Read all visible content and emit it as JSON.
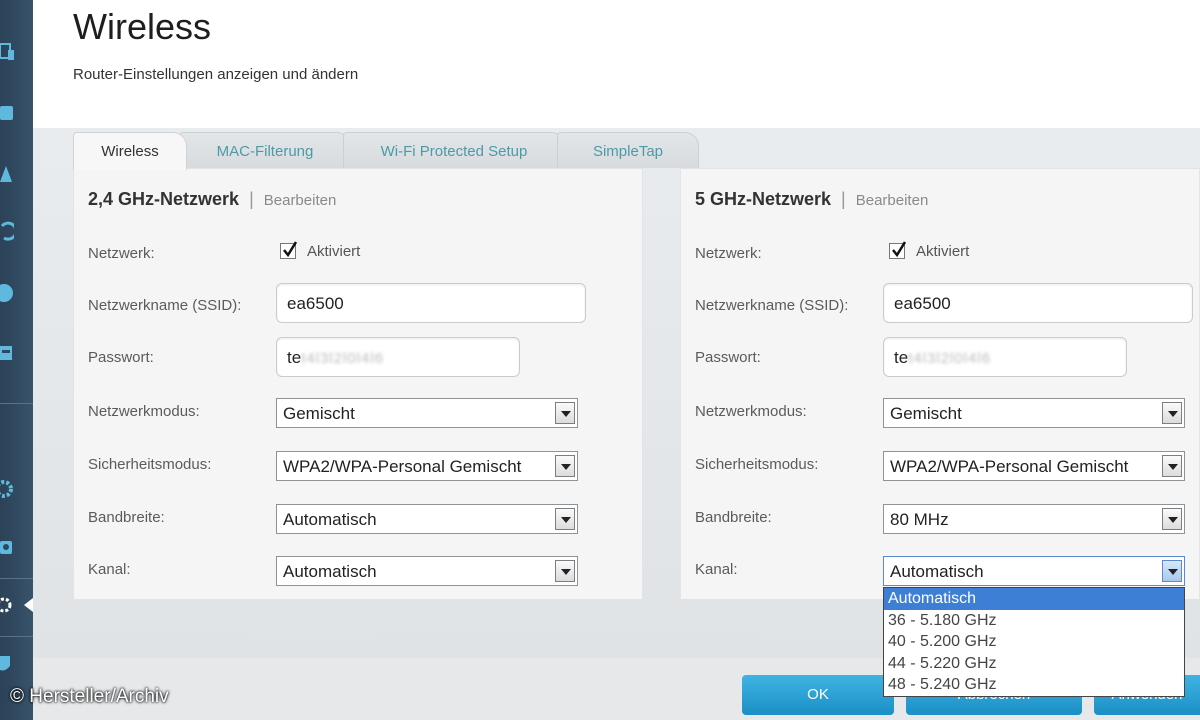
{
  "header": {
    "title": "Wireless",
    "subtitle": "Router-Einstellungen anzeigen und ändern"
  },
  "tabs": [
    {
      "label": "Wireless",
      "active": true
    },
    {
      "label": "MAC-Filterung",
      "active": false
    },
    {
      "label": "Wi-Fi Protected Setup",
      "active": false
    },
    {
      "label": "SimpleTap",
      "active": false
    }
  ],
  "sidebar": {
    "icons": [
      "devices-icon",
      "parental-icon",
      "warning-icon",
      "update-icon",
      "globe-icon",
      "media-icon",
      "gear-icon",
      "camera-icon",
      "wireless-settings-icon",
      "security-icon"
    ]
  },
  "labels": {
    "network": "Netzwerk:",
    "ssid": "Netzwerkname (SSID):",
    "password": "Passwort:",
    "mode": "Netzwerkmodus:",
    "security": "Sicherheitsmodus:",
    "bandwidth": "Bandbreite:",
    "channel": "Kanal:",
    "enabled": "Aktiviert",
    "edit": "Bearbeiten",
    "separator": "|"
  },
  "band24": {
    "title": "2,4 GHz-Netzwerk",
    "enabled": true,
    "ssid": "ea6500",
    "password_prefix": "te",
    "password_masked": "t4l3l2l0l4l6",
    "mode": "Gemischt",
    "security": "WPA2/WPA-Personal Gemischt",
    "bandwidth": "Automatisch",
    "channel": "Automatisch"
  },
  "band5": {
    "title": "5 GHz-Netzwerk",
    "enabled": true,
    "ssid": "ea6500",
    "password_prefix": "te",
    "password_masked": "t4l3l2l0l4l6",
    "mode": "Gemischt",
    "security": "WPA2/WPA-Personal Gemischt",
    "bandwidth": "80 MHz",
    "channel": "Automatisch",
    "channel_options": [
      "Automatisch",
      "36 - 5.180 GHz",
      "40 - 5.200 GHz",
      "44 - 5.220 GHz",
      "48 - 5.240 GHz"
    ]
  },
  "buttons": {
    "ok": "OK",
    "cancel": "Abbrechen",
    "apply": "Anwenden"
  },
  "watermark": "© Hersteller/Archiv",
  "colors": {
    "sidebar": "#2f4860",
    "tab_text": "#4d9aa7",
    "button": "#2a9fd6",
    "dropdown_selected": "#3e7fd6"
  }
}
